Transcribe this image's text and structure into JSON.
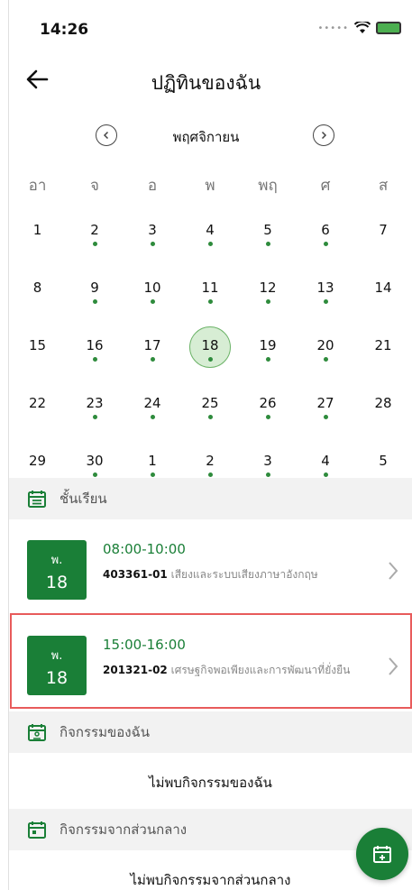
{
  "status": {
    "time": "14:26"
  },
  "header": {
    "title": "ปฏิทินของฉัน"
  },
  "calendar": {
    "month": "พฤศจิกายน",
    "weekdays": [
      "อา",
      "จ",
      "อ",
      "พ",
      "พฤ",
      "ศ",
      "ส"
    ],
    "weeks": [
      [
        {
          "d": "1",
          "dot": false
        },
        {
          "d": "2",
          "dot": true
        },
        {
          "d": "3",
          "dot": true
        },
        {
          "d": "4",
          "dot": true
        },
        {
          "d": "5",
          "dot": true
        },
        {
          "d": "6",
          "dot": true
        },
        {
          "d": "7",
          "dot": false
        }
      ],
      [
        {
          "d": "8",
          "dot": false
        },
        {
          "d": "9",
          "dot": true
        },
        {
          "d": "10",
          "dot": true
        },
        {
          "d": "11",
          "dot": true
        },
        {
          "d": "12",
          "dot": true
        },
        {
          "d": "13",
          "dot": true
        },
        {
          "d": "14",
          "dot": false
        }
      ],
      [
        {
          "d": "15",
          "dot": false
        },
        {
          "d": "16",
          "dot": true
        },
        {
          "d": "17",
          "dot": true
        },
        {
          "d": "18",
          "dot": true,
          "selected": true
        },
        {
          "d": "19",
          "dot": true
        },
        {
          "d": "20",
          "dot": true
        },
        {
          "d": "21",
          "dot": false
        }
      ],
      [
        {
          "d": "22",
          "dot": false
        },
        {
          "d": "23",
          "dot": true
        },
        {
          "d": "24",
          "dot": true
        },
        {
          "d": "25",
          "dot": true
        },
        {
          "d": "26",
          "dot": true
        },
        {
          "d": "27",
          "dot": true
        },
        {
          "d": "28",
          "dot": false
        }
      ],
      [
        {
          "d": "29",
          "dot": false
        },
        {
          "d": "30",
          "dot": true
        },
        {
          "d": "1",
          "dot": true
        },
        {
          "d": "2",
          "dot": true
        },
        {
          "d": "3",
          "dot": true
        },
        {
          "d": "4",
          "dot": true
        },
        {
          "d": "5",
          "dot": false
        }
      ]
    ]
  },
  "sections": {
    "classes": "ชั้นเรียน",
    "my_activities": "กิจกรรมของฉัน",
    "central_activities": "กิจกรรมจากส่วนกลาง"
  },
  "classes": [
    {
      "day_abbr": "พ.",
      "date": "18",
      "time": "08:00-10:00",
      "code": "403361-01",
      "name": "เสียงและระบบเสียงภาษาอังกฤษ"
    },
    {
      "day_abbr": "พ.",
      "date": "18",
      "time": "15:00-16:00",
      "code": "201321-02",
      "name": "เศรษฐกิจพอเพียงและการพัฒนาที่ยั่งยืน"
    }
  ],
  "empty": {
    "my_activities": "ไม่พบกิจกรรมของฉัน",
    "central_activities": "ไม่พบกิจกรรมจากส่วนกลาง"
  },
  "colors": {
    "accent": "#1a7f37",
    "highlight": "#e85b5b",
    "section_bg": "#f2f2f2"
  },
  "icons": {
    "back": "back-arrow-icon",
    "fab": "calendar-add-icon"
  }
}
